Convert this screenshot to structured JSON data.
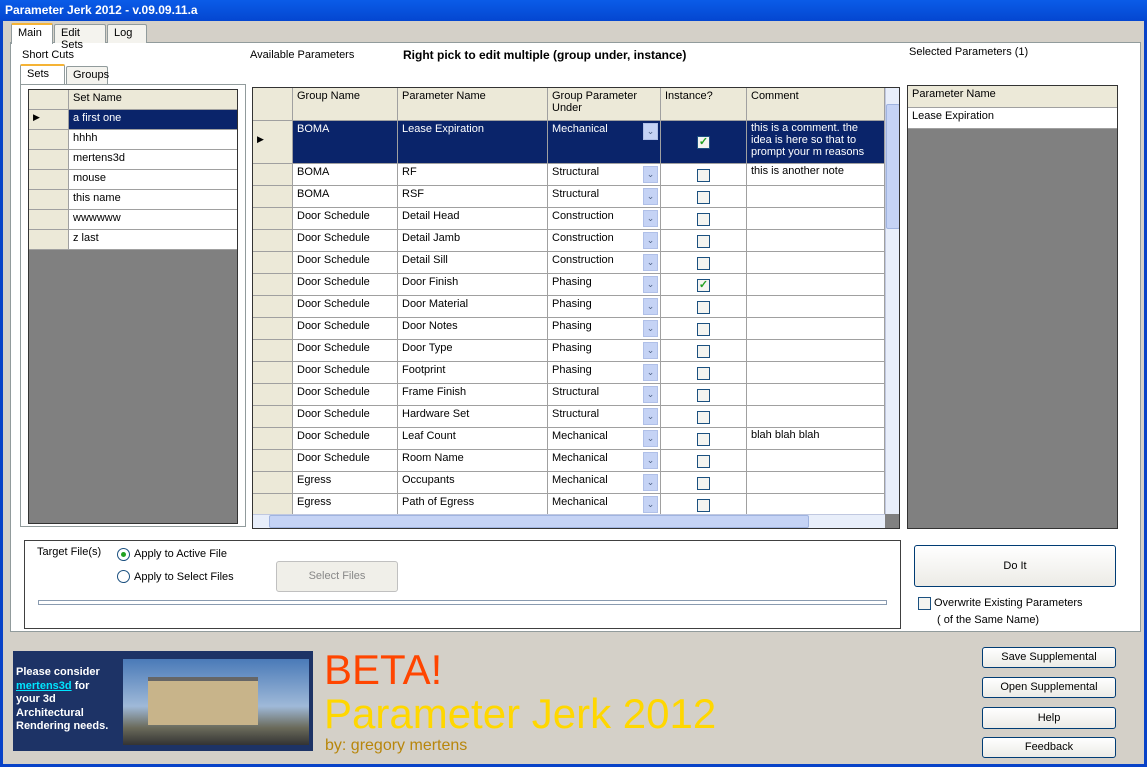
{
  "window": {
    "title": "Parameter Jerk 2012 - v.09.09.11.a"
  },
  "tabs": [
    {
      "label": "Main"
    },
    {
      "label": "Edit Sets"
    },
    {
      "label": "Log"
    }
  ],
  "shortcuts": {
    "label": "Short Cuts",
    "tabs": [
      {
        "label": "Sets"
      },
      {
        "label": "Groups"
      }
    ],
    "header": "Set Name",
    "sets": [
      "a first one",
      "hhhh",
      "mertens3d",
      "mouse",
      "this name",
      "wwwwww",
      "z last"
    ],
    "selected_index": 0
  },
  "available": {
    "label": "Available Parameters",
    "hint": "Right pick to edit multiple (group under, instance)",
    "columns": [
      "Group Name",
      "Parameter Name",
      "Group Parameter Under",
      "Instance?",
      "Comment"
    ],
    "rows": [
      {
        "group": "BOMA",
        "param": "Lease Expiration",
        "under": "Mechanical",
        "instance": true,
        "comment": "this is a comment. the idea is here so that to prompt your m reasons"
      },
      {
        "group": "BOMA",
        "param": "RF",
        "under": "Structural",
        "instance": false,
        "comment": "this is another note"
      },
      {
        "group": "BOMA",
        "param": "RSF",
        "under": "Structural",
        "instance": false,
        "comment": ""
      },
      {
        "group": "Door Schedule",
        "param": "Detail Head",
        "under": "Construction",
        "instance": false,
        "comment": ""
      },
      {
        "group": "Door Schedule",
        "param": "Detail Jamb",
        "under": "Construction",
        "instance": false,
        "comment": ""
      },
      {
        "group": "Door Schedule",
        "param": "Detail Sill",
        "under": "Construction",
        "instance": false,
        "comment": ""
      },
      {
        "group": "Door Schedule",
        "param": "Door Finish",
        "under": "Phasing",
        "instance": true,
        "comment": ""
      },
      {
        "group": "Door Schedule",
        "param": "Door Material",
        "under": "Phasing",
        "instance": false,
        "comment": ""
      },
      {
        "group": "Door Schedule",
        "param": "Door Notes",
        "under": "Phasing",
        "instance": false,
        "comment": ""
      },
      {
        "group": "Door Schedule",
        "param": "Door Type",
        "under": "Phasing",
        "instance": false,
        "comment": ""
      },
      {
        "group": "Door Schedule",
        "param": "Footprint",
        "under": "Phasing",
        "instance": false,
        "comment": ""
      },
      {
        "group": "Door Schedule",
        "param": "Frame Finish",
        "under": "Structural",
        "instance": false,
        "comment": ""
      },
      {
        "group": "Door Schedule",
        "param": "Hardware Set",
        "under": "Structural",
        "instance": false,
        "comment": ""
      },
      {
        "group": "Door Schedule",
        "param": "Leaf Count",
        "under": "Mechanical",
        "instance": false,
        "comment": "blah blah blah"
      },
      {
        "group": "Door Schedule",
        "param": "Room Name",
        "under": "Mechanical",
        "instance": false,
        "comment": ""
      },
      {
        "group": "Egress",
        "param": "Occupants",
        "under": "Mechanical",
        "instance": false,
        "comment": ""
      },
      {
        "group": "Egress",
        "param": "Path of Egress",
        "under": "Mechanical",
        "instance": false,
        "comment": ""
      }
    ]
  },
  "selected": {
    "label": "Selected Parameters (1)",
    "header": "Parameter Name",
    "items": [
      "Lease Expiration"
    ]
  },
  "target": {
    "label": "Target File(s)",
    "option_active": "Apply to Active File",
    "option_select": "Apply to Select Files",
    "select_files": "Select Files",
    "active_selected": true
  },
  "do_it": "Do It",
  "overwrite": {
    "line1": "Overwrite Existing Parameters",
    "line2": "( of the Same Name)",
    "checked": false
  },
  "banner": {
    "line1": "Please consider",
    "link": "mertens3d",
    "line1b": " for",
    "line2": "your 3d",
    "line3": "Architectural",
    "line4": "Rendering needs."
  },
  "beta": "BETA!",
  "product": "Parameter Jerk 2012",
  "author": "by: gregory mertens",
  "buttons": {
    "save": "Save Supplemental",
    "open": "Open Supplemental",
    "help": "Help",
    "feedback": "Feedback"
  },
  "colors": {
    "beta": "#ff4500",
    "product": "#ffd700",
    "author": "#b8860b",
    "selection": "#0a246a"
  }
}
